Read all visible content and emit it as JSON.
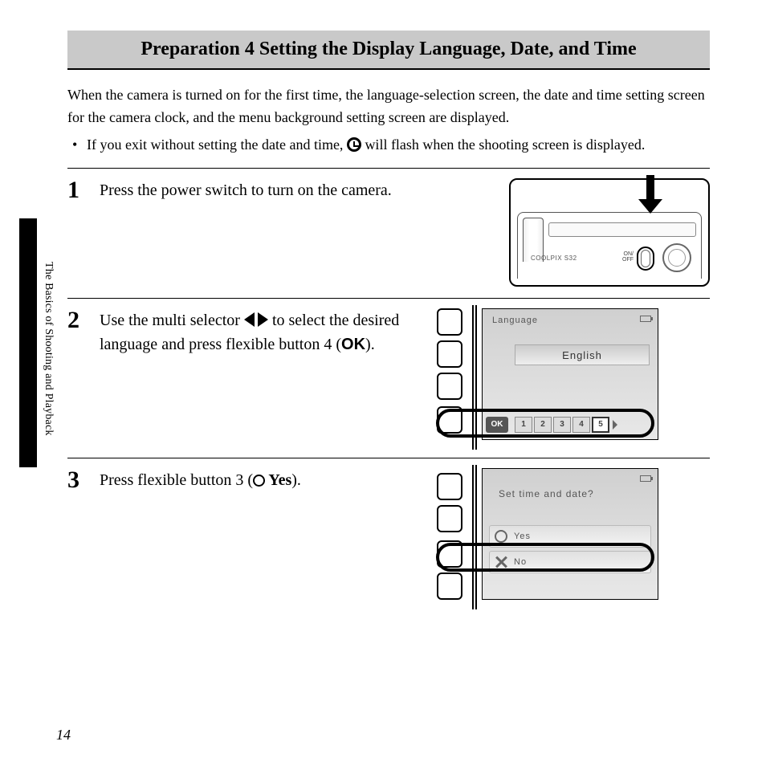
{
  "title": "Preparation 4 Setting the Display Language, Date, and Time",
  "intro": "When the camera is turned on for the first time, the language-selection screen, the date and time setting screen for the camera clock, and the menu background setting screen are displayed.",
  "bullet_pre": "If you exit without setting the date and time, ",
  "bullet_post": " will flash when the shooting screen is displayed.",
  "step1": {
    "num": "1",
    "text": "Press the power switch to turn on the camera."
  },
  "step2": {
    "num": "2",
    "text_pre": "Use the multi selector ",
    "text_mid": " to select the desired language and press flexible button 4 (",
    "ok_label": "OK",
    "text_post": ")."
  },
  "step3": {
    "num": "3",
    "text_pre": "Press flexible button 3 (",
    "yes_label": " Yes",
    "text_post": ")."
  },
  "camera": {
    "model": "COOLPIX S32",
    "onoff": "ON/\nOFF"
  },
  "screen_lang": {
    "title": "Language",
    "value": "English",
    "pages": [
      "1",
      "2",
      "3",
      "4",
      "5"
    ],
    "ok": "OK"
  },
  "screen_time": {
    "question": "Set time and date?",
    "yes": "Yes",
    "no": "No"
  },
  "side_label": "The Basics of Shooting and Playback",
  "page_number": "14"
}
